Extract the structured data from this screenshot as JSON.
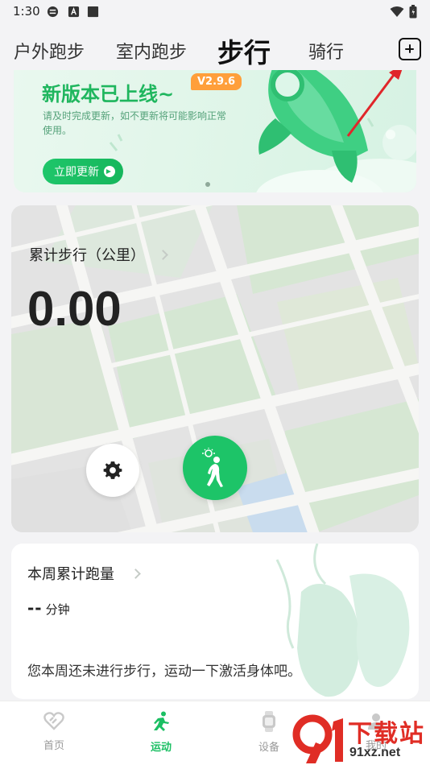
{
  "status_bar": {
    "time": "1:30"
  },
  "tabs": [
    {
      "label": "户外跑步",
      "active": false
    },
    {
      "label": "室内跑步",
      "active": false
    },
    {
      "label": "步行",
      "active": true
    },
    {
      "label": "骑行",
      "active": false
    }
  ],
  "add_button_icon": "plus-square-icon",
  "banner": {
    "title": "新版本已上线~",
    "version_badge": "V2.9.6",
    "description": "请及时完成更新，如不更新将可能影响正常使用。",
    "button_label": "立即更新"
  },
  "map_card": {
    "label": "累计步行（公里）",
    "value": "0.00",
    "settings_icon": "gear-icon",
    "start_icon": "walking-person-icon"
  },
  "weekly": {
    "title": "本周累计跑量",
    "value": "--",
    "unit": "分钟",
    "message": "您本周还未进行步行，运动一下激活身体吧。"
  },
  "bottom_nav": [
    {
      "label": "首页",
      "icon": "home-heart-icon",
      "active": false
    },
    {
      "label": "运动",
      "icon": "running-person-icon",
      "active": true
    },
    {
      "label": "设备",
      "icon": "watch-icon",
      "active": false
    },
    {
      "label": "我的",
      "icon": "profile-icon",
      "active": false
    }
  ],
  "watermark": {
    "line1": "下载站",
    "line2": "91xz.net"
  },
  "colors": {
    "accent": "#1bbf63",
    "badge": "#ff9f3a",
    "annotation_arrow": "#e0262a"
  }
}
